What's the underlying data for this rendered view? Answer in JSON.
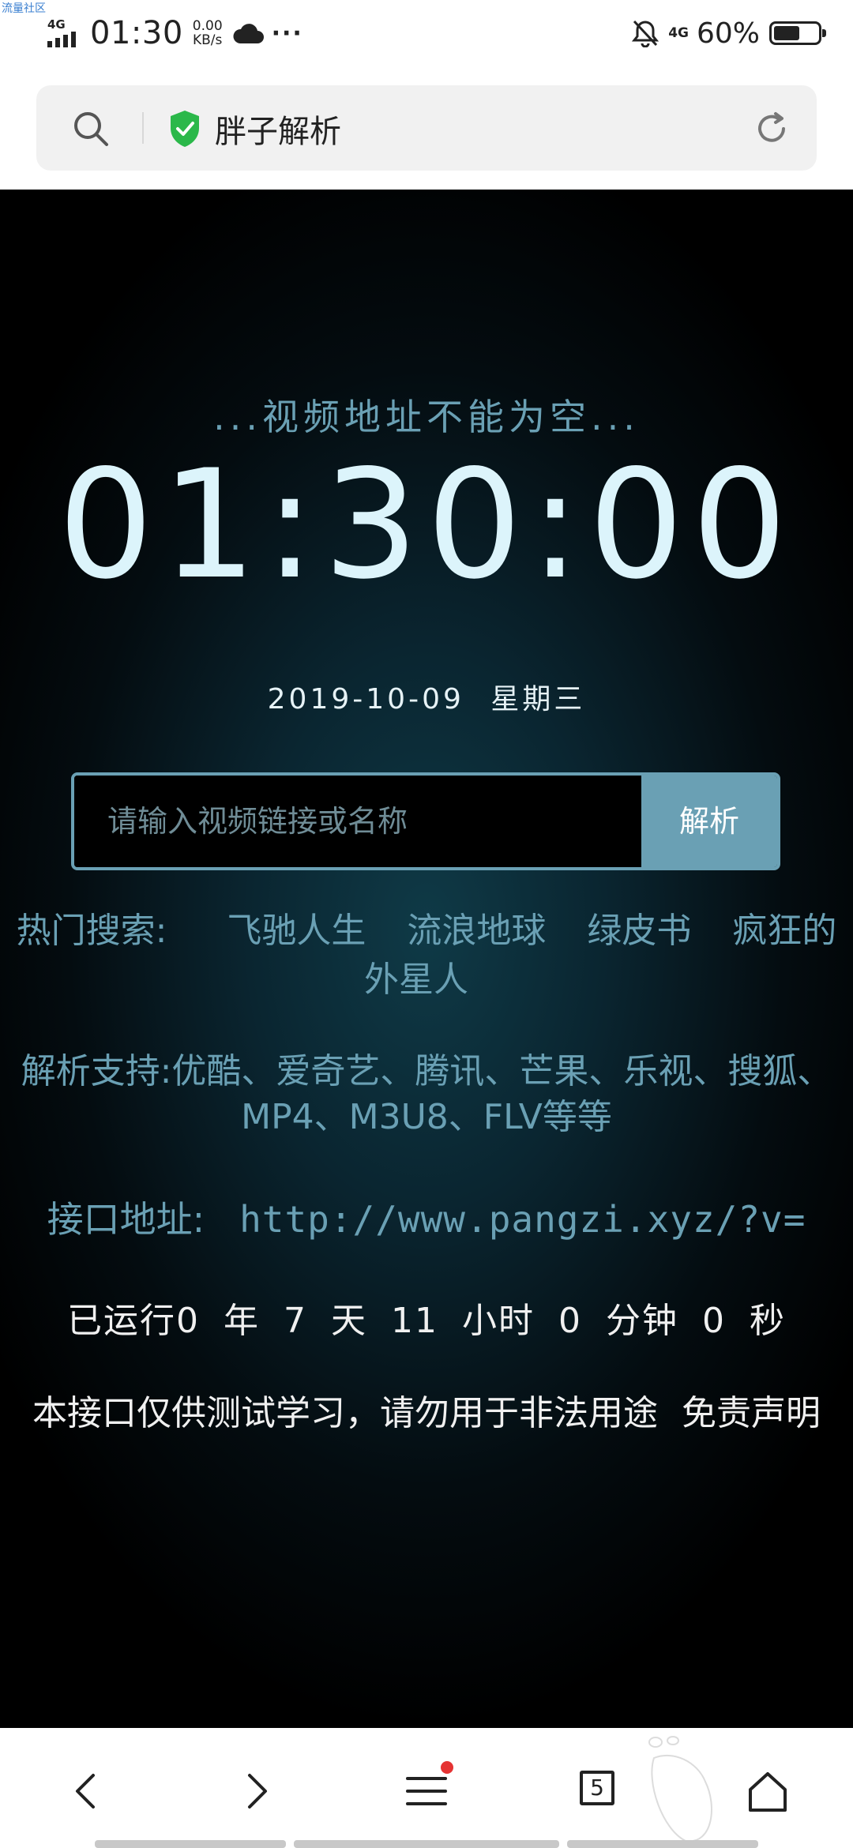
{
  "status_bar": {
    "watermark": "流量社区",
    "network_type_left": "4G",
    "time": "01:30",
    "speed_value": "0.00",
    "speed_unit": "KB/s",
    "more": "···",
    "network_type_right": "4G",
    "battery_percent": "60%",
    "battery_level": 0.6
  },
  "address_bar": {
    "title": "胖子解析",
    "secure_icon": "shield-check-icon",
    "search_icon": "search-icon",
    "refresh_icon": "refresh-icon"
  },
  "main": {
    "error_message": "...视频地址不能为空...",
    "clock": "01:30:00",
    "date": "2019-10-09",
    "weekday": "星期三",
    "search": {
      "placeholder": "请输入视频链接或名称",
      "button_label": "解析"
    },
    "hot_search": {
      "label": "热门搜索:",
      "items": [
        "飞驰人生",
        "流浪地球",
        "绿皮书",
        "疯狂的外星人"
      ]
    },
    "support": {
      "label": "解析支持:",
      "text": "优酷、爱奇艺、腾讯、芒果、乐视、搜狐、MP4、M3U8、FLV等等"
    },
    "api": {
      "label": "接口地址:",
      "url": "http://www.pangzi.xyz/?v="
    },
    "uptime": {
      "prefix": "已运行",
      "years": "0",
      "years_unit": "年",
      "days": "7",
      "days_unit": "天",
      "hours": "11",
      "hours_unit": "小时",
      "minutes": "0",
      "minutes_unit": "分钟",
      "seconds": "0",
      "seconds_unit": "秒"
    },
    "disclaimer": {
      "text": "本接口仅供测试学习，请勿用于非法用途",
      "link": "免责声明"
    }
  },
  "bottom_nav": {
    "back_icon": "chevron-left-icon",
    "forward_icon": "chevron-right-icon",
    "menu_icon": "menu-icon",
    "tab_count": "5",
    "home_icon": "home-icon",
    "menu_badge_color": "#e53333"
  }
}
